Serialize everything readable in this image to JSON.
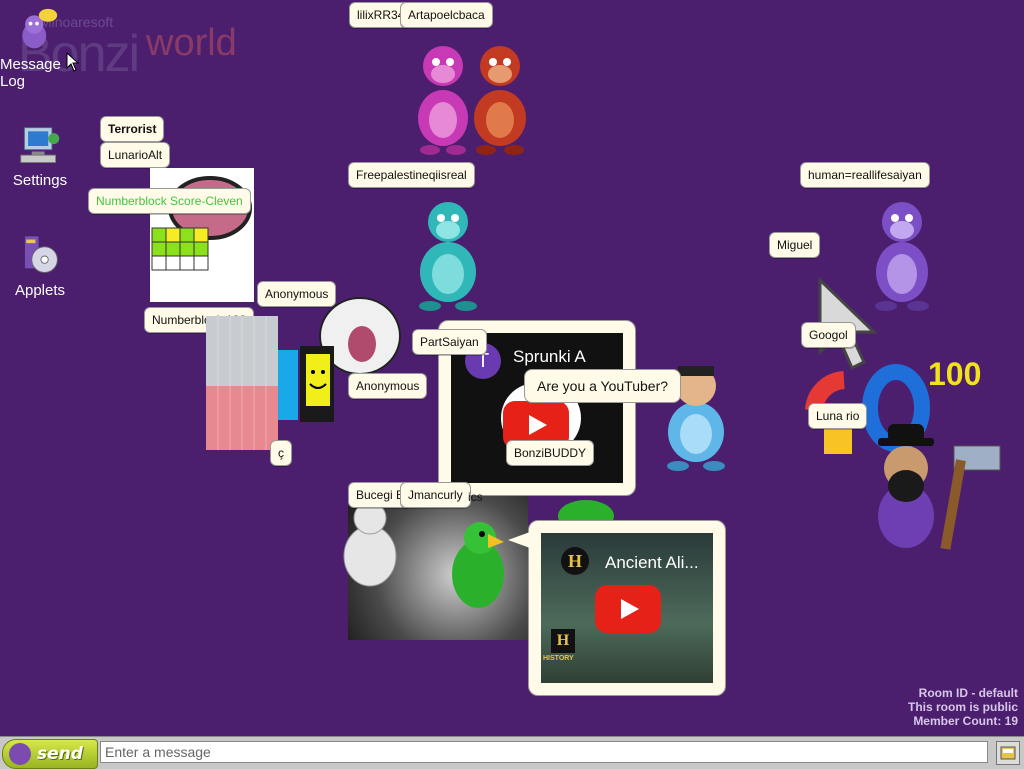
{
  "logo": {
    "small": "Minoaresoft",
    "big": "Bonzi",
    "world": "world"
  },
  "desktop": [
    {
      "label": "Message Log",
      "icon": "message-log-icon"
    },
    {
      "label": "Settings",
      "icon": "settings-icon"
    },
    {
      "label": "Applets",
      "icon": "applets-icon"
    }
  ],
  "users": {
    "u1": "lilixRR34",
    "u2": "Artapoelcbaca",
    "u3": "Terrorist",
    "u4": "LunarioAlt",
    "u5": "Numberblock Score-Cleven",
    "u6": "Freepalestineqiisreal",
    "u7": "human=reallifesaiyan",
    "u8": "Miguel",
    "u9": "Anonymous",
    "u10": "Numberblock 190",
    "u11": "PartSaiyan",
    "u12": "Googol",
    "u13": "Anonymous",
    "u14": "Luna rio",
    "u15": "ç",
    "u16": "BonziBUDDY",
    "u17": "Bucegi B",
    "u18": "Jmancurly",
    "u19": "ics"
  },
  "bubbles": {
    "video1_title": "Sprunki A",
    "video1_letter": "T",
    "speech1": "Are you a YouTuber?",
    "video2_title": "Ancient Ali...",
    "history_logo": "H",
    "history_text": "HISTORY"
  },
  "decor": {
    "score_100": "100"
  },
  "room": {
    "line1": "Room ID - default",
    "line2": "This room is public",
    "line3": "Member Count: 19"
  },
  "chat": {
    "send_label": "send",
    "placeholder": "Enter a message"
  },
  "colors": {
    "background": "#4b1f6e",
    "tag_bg": "#fffbe8",
    "send_green": "#98b421"
  }
}
